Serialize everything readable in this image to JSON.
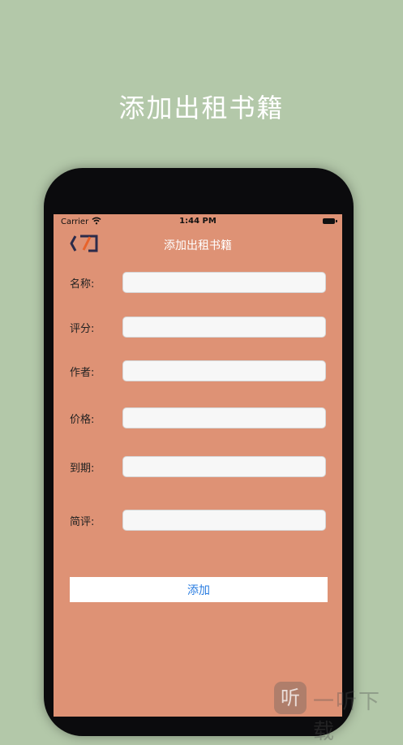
{
  "promo": {
    "title": "添加出租书籍"
  },
  "status_bar": {
    "carrier": "Carrier",
    "time": "1:44 PM"
  },
  "nav": {
    "title": "添加出租书籍",
    "back_icon": "back-arrow-icon"
  },
  "form": {
    "fields": [
      {
        "label": "名称:",
        "value": "",
        "placeholder": ""
      },
      {
        "label": "评分:",
        "value": "",
        "placeholder": ""
      },
      {
        "label": "作者:",
        "value": "",
        "placeholder": ""
      },
      {
        "label": "价格:",
        "value": "",
        "placeholder": ""
      },
      {
        "label": "到期:",
        "value": "",
        "placeholder": ""
      },
      {
        "label": "简评:",
        "value": "",
        "placeholder": ""
      }
    ],
    "submit_label": "添加"
  },
  "watermark": {
    "logo_glyph": "听",
    "text": "一听下载"
  },
  "colors": {
    "background": "#b3c8a9",
    "screen": "#de9275",
    "button_text": "#2a7de1",
    "back_icon_dark": "#2b2b4a",
    "back_icon_accent": "#e8632b"
  }
}
